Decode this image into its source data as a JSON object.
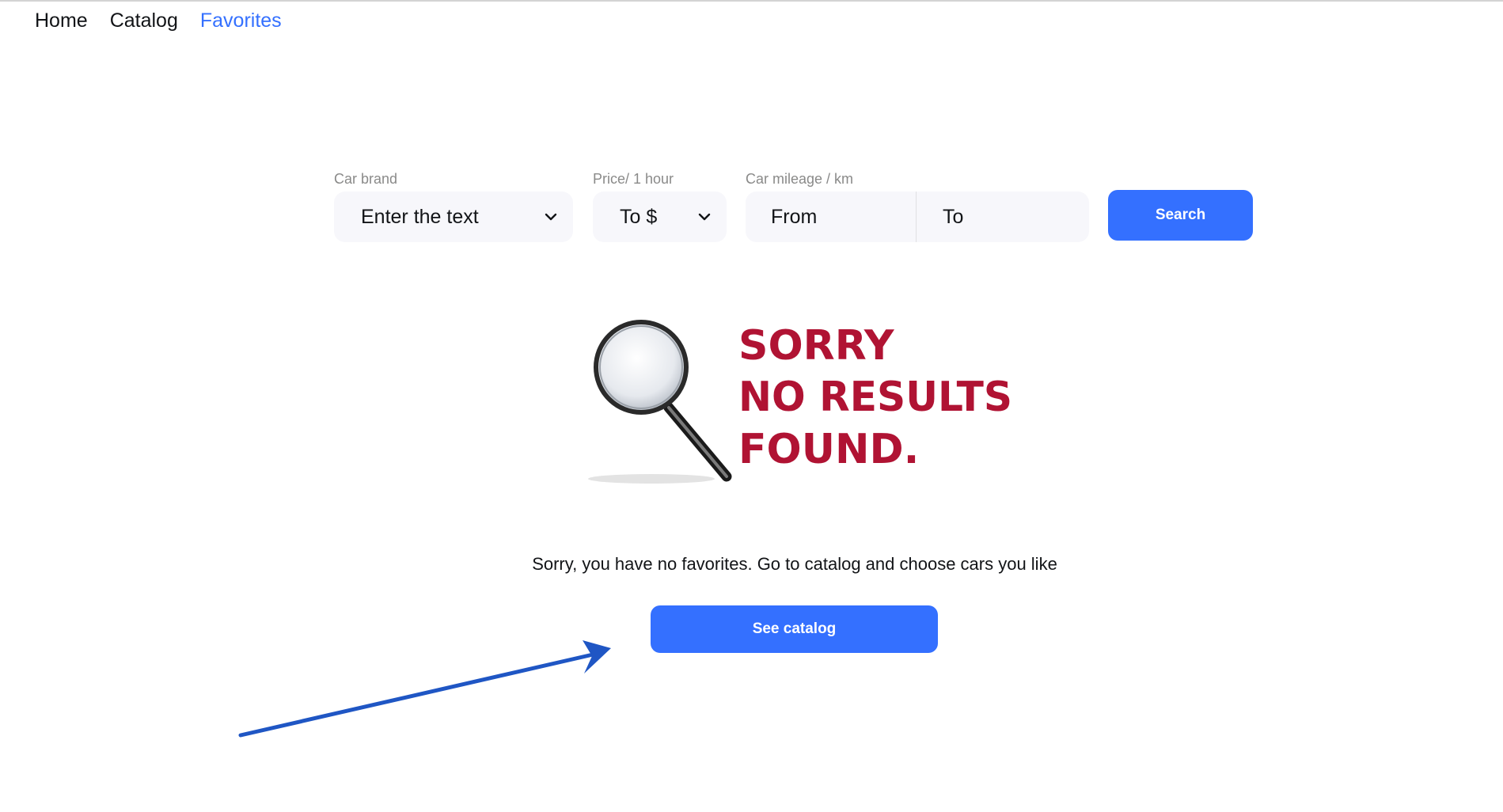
{
  "nav": {
    "items": [
      {
        "label": "Home"
      },
      {
        "label": "Catalog"
      },
      {
        "label": "Favorites"
      }
    ],
    "active_color": "#3470ff"
  },
  "filters": {
    "brand": {
      "label": "Car brand",
      "value": "Enter the text"
    },
    "price": {
      "label": "Price/ 1 hour",
      "value": "To $"
    },
    "mileage": {
      "label": "Car mileage / km",
      "from": "From",
      "to": "To"
    },
    "search_label": "Search"
  },
  "empty_state": {
    "image_text": [
      "SORRY",
      "NO RESULTS",
      "FOUND."
    ],
    "image_text_color": "#b01333",
    "message": "Sorry, you have no favorites. Go to catalog and choose cars you like",
    "button_label": "See catalog"
  },
  "accent_color": "#3470ff"
}
